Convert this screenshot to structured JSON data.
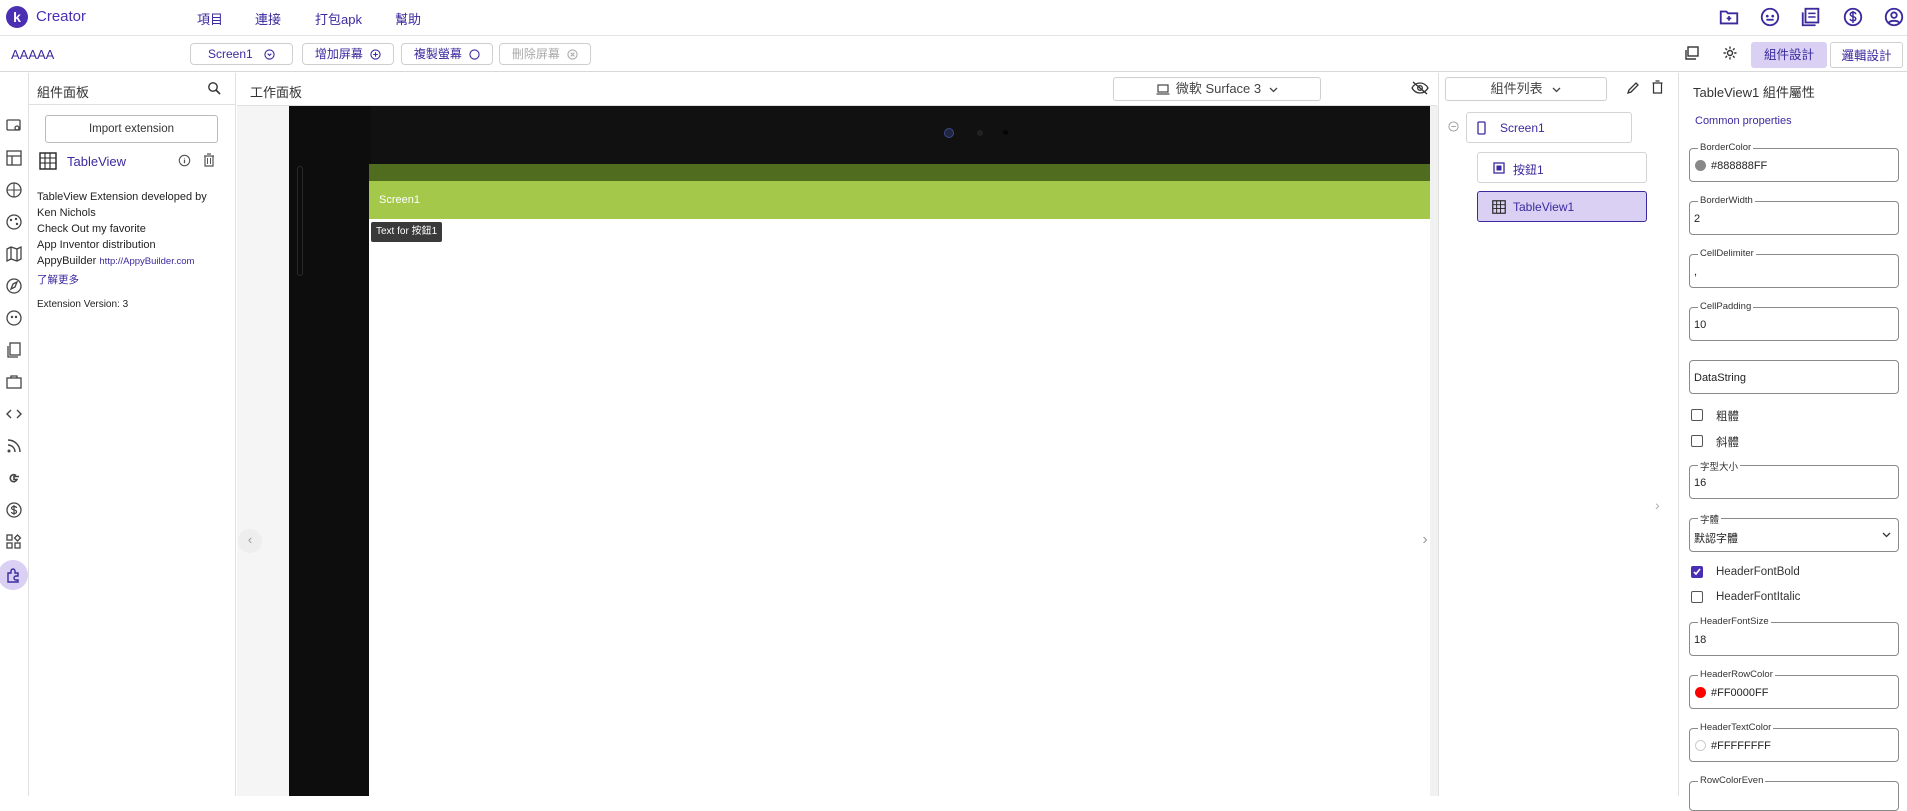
{
  "app": {
    "brand": "Creator",
    "logo_letter": "k"
  },
  "menu": [
    "項目",
    "連接",
    "打包apk",
    "幫助"
  ],
  "top_icons": [
    "folder-add-icon",
    "gamepad-icon",
    "library-icon",
    "dollar-icon",
    "account-icon"
  ],
  "toolbar": {
    "project_name": "AAAAA",
    "screen_select": "Screen1",
    "add_screen": "增加屏幕",
    "copy_screen": "複製螢幕",
    "delete_screen": "刪除屏幕",
    "designer_tab": "組件設計",
    "blocks_tab": "邏輯設計"
  },
  "palette": {
    "title": "組件面板",
    "import_button": "Import extension",
    "extension_name": "TableView",
    "description_lines": [
      "TableView Extension developed by",
      "Ken Nichols",
      "Check Out my favorite",
      "App Inventor distribution"
    ],
    "appybuilder_prefix": "AppyBuilder",
    "appybuilder_link": "http://AppyBuilder.com",
    "learn_more": "了解更多",
    "version": "Extension Version: 3"
  },
  "workspace": {
    "title": "工作面板",
    "device_select": "微軟 Surface 3",
    "screen_title": "Screen1",
    "button_text": "Text for 按鈕1",
    "colors": {
      "status_bar": "#4f6c1f",
      "title_bar": "#a4c94a"
    }
  },
  "tree": {
    "title": "組件列表",
    "items": [
      {
        "label": "Screen1",
        "icon": "phone-icon"
      },
      {
        "label": "按鈕1",
        "icon": "button-icon"
      },
      {
        "label": "TableView1",
        "icon": "table-icon"
      }
    ]
  },
  "properties": {
    "title": "TableView1 組件屬性",
    "section": "Common properties",
    "fields": [
      {
        "label": "BorderColor",
        "value": "#888888FF",
        "swatch": "#888888"
      },
      {
        "label": "BorderWidth",
        "value": "2"
      },
      {
        "label": "CellDelimiter",
        "value": ","
      },
      {
        "label": "CellPadding",
        "value": "10"
      },
      {
        "label": "",
        "value": "DataString"
      },
      {
        "label": "字型大小",
        "value": "16"
      },
      {
        "label": "字體",
        "value": "默認字體"
      },
      {
        "label": "HeaderFontSize",
        "value": "18"
      },
      {
        "label": "HeaderRowColor",
        "value": "#FF0000FF",
        "swatch": "#ff0000"
      },
      {
        "label": "HeaderTextColor",
        "value": "#FFFFFFFF",
        "swatch": "#ffffff"
      },
      {
        "label": "RowColorEven",
        "value": ""
      }
    ],
    "checks": [
      {
        "label": "粗體",
        "checked": false
      },
      {
        "label": "斜體",
        "checked": false
      },
      {
        "label": "HeaderFontBold",
        "checked": true
      },
      {
        "label": "HeaderFontItalic",
        "checked": false
      }
    ]
  },
  "accent": "#4a2fb3"
}
